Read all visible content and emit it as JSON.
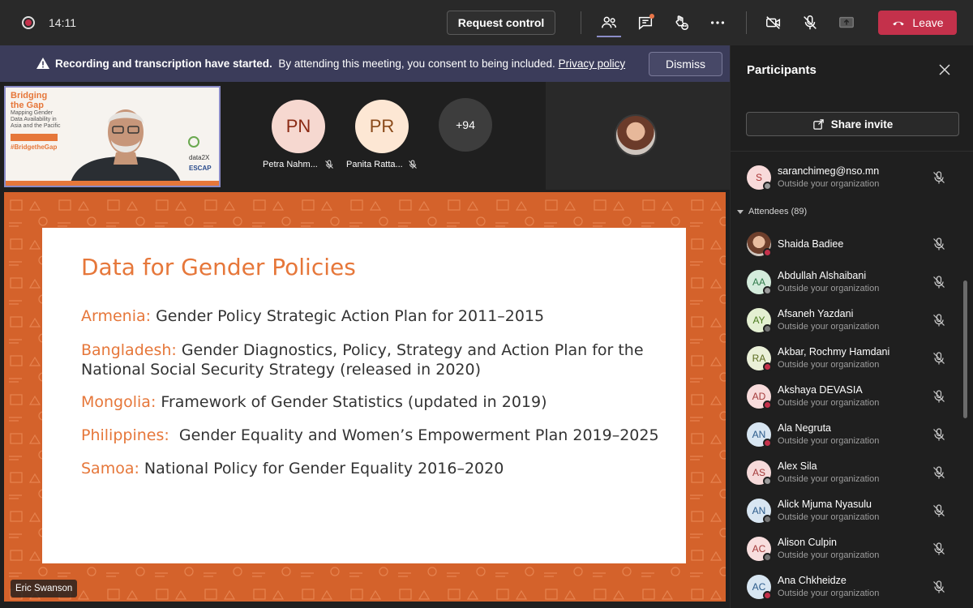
{
  "topbar": {
    "time": "14:11",
    "request_control": "Request control",
    "leave": "Leave"
  },
  "banner": {
    "title": "Recording and transcription have started.",
    "text": "By attending this meeting, you consent to being included.",
    "link": "Privacy policy",
    "dismiss": "Dismiss"
  },
  "strip": {
    "thumb": {
      "title": "Bridging\nthe Gap",
      "subtitle": "Mapping Gender\nData Availability in\nAsia and the Pacific",
      "hashtag": "#BridgetheGap",
      "logo_data2x": "data2X",
      "logo_escap": "ESCAP"
    },
    "tiles": [
      {
        "initials": "PN",
        "name": "Petra Nahm...",
        "bg": "#f6d8d0",
        "fg": "#8b2a14"
      },
      {
        "initials": "PR",
        "name": "Panita Ratta...",
        "bg": "#fde7d4",
        "fg": "#8a4a1a"
      }
    ],
    "more": "+94"
  },
  "slide": {
    "title": "Data for Gender Policies",
    "items": [
      {
        "country": "Armenia:",
        "text": " Gender Policy Strategic Action Plan for 2011–2015"
      },
      {
        "country": "Bangladesh:",
        "text": " Gender Diagnostics, Policy, Strategy and Action Plan for the National Social Security Strategy (released in 2020)"
      },
      {
        "country": "Mongolia:",
        "text": " Framework of Gender Statistics (updated in 2019)"
      },
      {
        "country": "Philippines:",
        "text": "  Gender Equality and Women’s Empowerment Plan 2019–2025"
      },
      {
        "country": "Samoa:",
        "text": " National Policy for Gender Equality 2016–2020"
      }
    ],
    "presenter": "Eric Swanson"
  },
  "panel": {
    "title": "Participants",
    "share_invite": "Share invite",
    "attendees_header": "Attendees (89)",
    "org_label": "Outside your organization",
    "top_participant": {
      "initials": "S",
      "name": "saranchimeg@nso.mn",
      "org": "Outside your organization",
      "bg": "#f8dada",
      "fg": "#a33",
      "status": "#9a9a9a"
    },
    "attendees": [
      {
        "initials": "",
        "name": "Shaida Badiee",
        "org": "",
        "bg": "#c89b7b",
        "fg": "#fff",
        "status": "#c4314b",
        "photo": true
      },
      {
        "initials": "AA",
        "name": "Abdullah Alshaibani",
        "org": "Outside your organization",
        "bg": "#d4ecdc",
        "fg": "#2f7a4a",
        "status": "#9a9a9a"
      },
      {
        "initials": "AY",
        "name": "Afsaneh Yazdani",
        "org": "Outside your organization",
        "bg": "#e4f0d2",
        "fg": "#4a7a1e",
        "status": "#777777"
      },
      {
        "initials": "RA",
        "name": "Akbar, Rochmy Hamdani",
        "org": "Outside your organization",
        "bg": "#eaf0d8",
        "fg": "#5a6a1e",
        "status": "#c4314b"
      },
      {
        "initials": "AD",
        "name": "Akshaya DEVASIA",
        "org": "Outside your organization",
        "bg": "#f8dcdc",
        "fg": "#a33a3a",
        "status": "#c4314b"
      },
      {
        "initials": "AN",
        "name": "Ala Negruta",
        "org": "Outside your organization",
        "bg": "#d8e6f2",
        "fg": "#2a5a8a",
        "status": "#c4314b"
      },
      {
        "initials": "AS",
        "name": "Alex Sila",
        "org": "Outside your organization",
        "bg": "#f6dada",
        "fg": "#a33a3a",
        "status": "#9a9a9a"
      },
      {
        "initials": "AN",
        "name": "Alick Mjuma Nyasulu",
        "org": "Outside your organization",
        "bg": "#d8e6f2",
        "fg": "#2a5a8a",
        "status": "#777777"
      },
      {
        "initials": "AC",
        "name": "Alison Culpin",
        "org": "Outside your organization",
        "bg": "#f8dede",
        "fg": "#a33a3a",
        "status": "#777777"
      },
      {
        "initials": "AC",
        "name": "Ana Chkheidze",
        "org": "Outside your organization",
        "bg": "#d8e6f2",
        "fg": "#2a5a8a",
        "status": "#c4314b"
      }
    ]
  }
}
